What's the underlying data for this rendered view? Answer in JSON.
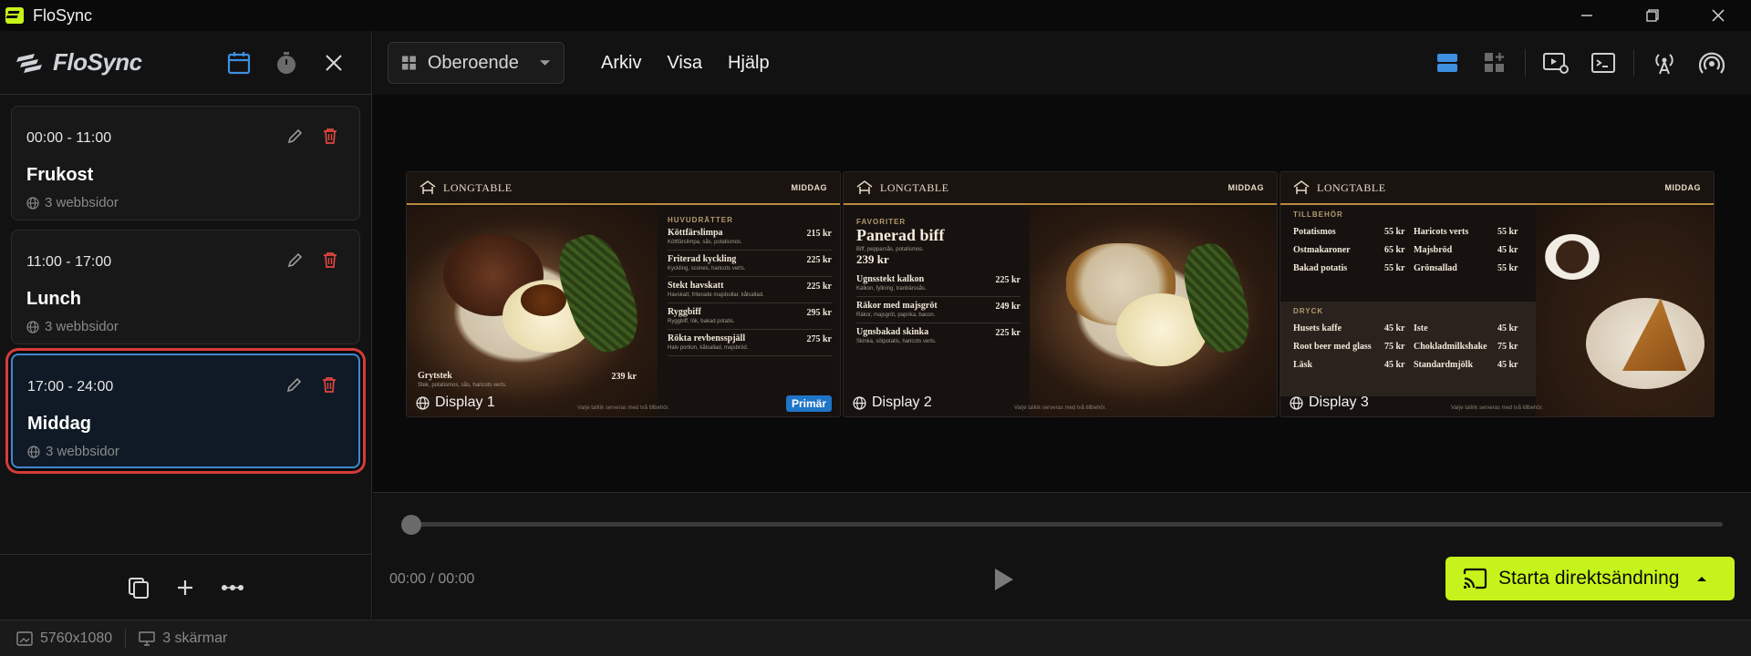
{
  "window": {
    "title": "FloSync"
  },
  "sidebar": {
    "brand": "FloSync",
    "schedules": [
      {
        "time": "00:00 - 11:00",
        "name": "Frukost",
        "pages": "3 webbsidor",
        "selected": false
      },
      {
        "time": "11:00 - 17:00",
        "name": "Lunch",
        "pages": "3 webbsidor",
        "selected": false
      },
      {
        "time": "17:00 - 24:00",
        "name": "Middag",
        "pages": "3 webbsidor",
        "selected": true
      }
    ]
  },
  "toolbar": {
    "layout_select": "Oberoende",
    "menu": [
      "Arkiv",
      "Visa",
      "Hjälp"
    ]
  },
  "displays": [
    {
      "label": "Display 1",
      "badge": "Primär",
      "brand": "LONGTABLE",
      "tag": "MIDDAG",
      "section": "HUVUDRÄTTER",
      "items": [
        {
          "name": "Köttfärslimpa",
          "price": "215 kr",
          "desc": "Köttfärslimpa, sås, potatismos."
        },
        {
          "name": "Friterad kyckling",
          "price": "225 kr",
          "desc": "Kyckling, scones, haricots verts."
        },
        {
          "name": "Stekt havskatt",
          "price": "225 kr",
          "desc": "Havskatt, friterade majsbollar, kålsallad."
        },
        {
          "name": "Ryggbiff",
          "price": "295 kr",
          "desc": "Ryggbiff, lök, bakad potatis."
        },
        {
          "name": "Rökta revbensspjäll",
          "price": "275 kr",
          "desc": "Halv portion, kålsallad, majsbröd."
        }
      ],
      "feature": {
        "name": "Grytstek",
        "price": "239 kr",
        "desc": "Stek, potatismos, sås, haricots verts."
      },
      "footer": "Varje tallrik serveras med två tillbehör."
    },
    {
      "label": "Display 2",
      "brand": "LONGTABLE",
      "tag": "MIDDAG",
      "section": "FAVORITER",
      "title": "Panerad biff",
      "title_desc": "Biff, pepparsås, potatismos.",
      "title_price": "239 kr",
      "items": [
        {
          "name": "Ugnsstekt kalkon",
          "price": "225 kr",
          "desc": "Kalkon, fyllning, tranbärssås."
        },
        {
          "name": "Räkor med majsgröt",
          "price": "249 kr",
          "desc": "Räkor, majsgröt, paprika, bacon."
        },
        {
          "name": "Ugnsbakad skinka",
          "price": "225 kr",
          "desc": "Skinka, sötpotatis, haricots verts."
        }
      ],
      "footer": "Varje tallrik serveras med två tillbehör."
    },
    {
      "label": "Display 3",
      "brand": "LONGTABLE",
      "tag": "MIDDAG",
      "sides_title": "TILLBEHÖR",
      "sides": [
        [
          "Potatismos",
          "55 kr",
          "Haricots verts",
          "55 kr"
        ],
        [
          "Ostmakaroner",
          "65 kr",
          "Majsbröd",
          "45 kr"
        ],
        [
          "Bakad potatis",
          "55 kr",
          "Grönsallad",
          "55 kr"
        ]
      ],
      "drinks_title": "DRYCK",
      "drinks": [
        [
          "Husets kaffe",
          "45 kr",
          "Iste",
          "45 kr"
        ],
        [
          "Root beer med glass",
          "75 kr",
          "Chokladmilkshake",
          "75 kr"
        ],
        [
          "Läsk",
          "45 kr",
          "Standardmjölk",
          "45 kr"
        ]
      ],
      "footer": "Varje tallrik serveras med två tillbehör."
    }
  ],
  "transport": {
    "time": "00:00 / 00:00",
    "progress": 0,
    "live_button": "Starta direktsändning"
  },
  "status": {
    "resolution": "5760x1080",
    "screens": "3 skärmar"
  },
  "colors": {
    "accent": "#c6f31b",
    "selection": "#3f88cf",
    "highlight": "#d63b3b",
    "menu_gold": "#b9893c"
  }
}
